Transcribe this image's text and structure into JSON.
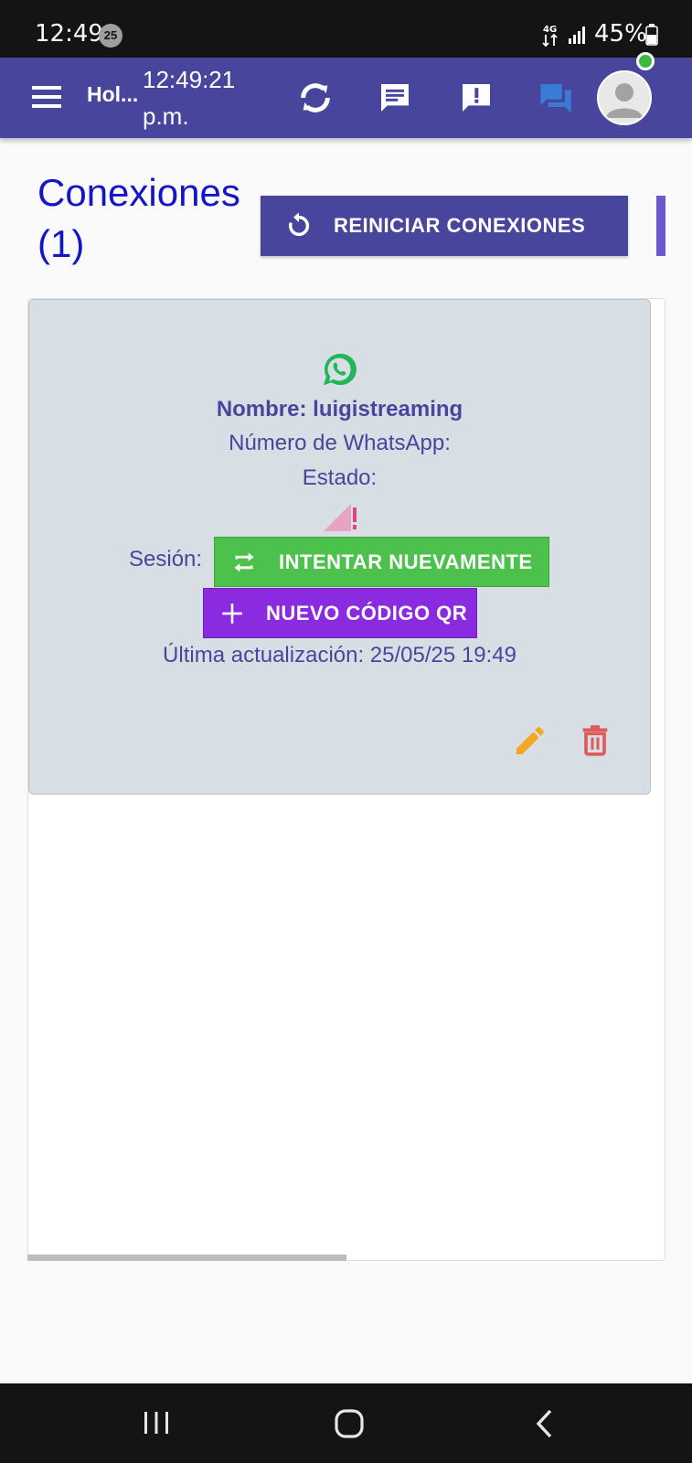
{
  "status_bar": {
    "time": "12:49",
    "notification_count": "25",
    "network_label": "4G",
    "battery_percent": "45%"
  },
  "app_bar": {
    "title": "Hol...",
    "clock": "12:49:21 p.m.",
    "icons": [
      "menu-icon",
      "refresh-icon",
      "chat-icon",
      "alert-icon",
      "forum-icon",
      "avatar"
    ],
    "colors": {
      "bar": "#48469c",
      "forum_icon": "#3a7bd5",
      "online": "#3dba3d"
    }
  },
  "page": {
    "title": "Conexiones (1)",
    "restart_button": "REINICIAR CONEXIONES"
  },
  "connection": {
    "name": "Nombre: luigistreaming",
    "number_label": "Número de WhatsApp:",
    "state_label": "Estado:",
    "session_label": "Sesión:",
    "retry_button": "INTENTAR NUEVAMENTE",
    "qr_button": "NUEVO CÓDIGO QR",
    "last_update": "Última actualización: 25/05/25 19:49",
    "colors": {
      "whatsapp": "#25b557",
      "retry": "#4cc14c",
      "qr": "#8a2be2",
      "edit": "#f5a623",
      "delete": "#e05a5a",
      "warning": "#e0457a"
    }
  }
}
